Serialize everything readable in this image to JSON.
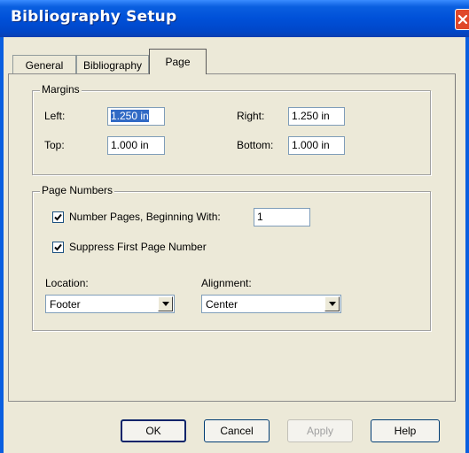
{
  "window": {
    "title": "Bibliography Setup"
  },
  "tabs": [
    {
      "label": "General"
    },
    {
      "label": "Bibliography"
    },
    {
      "label": "Page"
    }
  ],
  "margins": {
    "group_label": "Margins",
    "left_label": "Left:",
    "left_value": "1.250 in",
    "right_label": "Right:",
    "right_value": "1.250 in",
    "top_label": "Top:",
    "top_value": "1.000 in",
    "bottom_label": "Bottom:",
    "bottom_value": "1.000 in"
  },
  "page_numbers": {
    "group_label": "Page Numbers",
    "number_pages_label": "Number Pages, Beginning With:",
    "number_pages_checked": true,
    "start_value": "1",
    "suppress_label": "Suppress First Page Number",
    "suppress_checked": true,
    "location_label": "Location:",
    "location_value": "Footer",
    "alignment_label": "Alignment:",
    "alignment_value": "Center"
  },
  "buttons": {
    "ok": "OK",
    "cancel": "Cancel",
    "apply": "Apply",
    "help": "Help"
  },
  "colors": {
    "titlebar": "#0050d8",
    "dialog_bg": "#ece9d8",
    "selection": "#316ac5",
    "close": "#e0482a"
  }
}
